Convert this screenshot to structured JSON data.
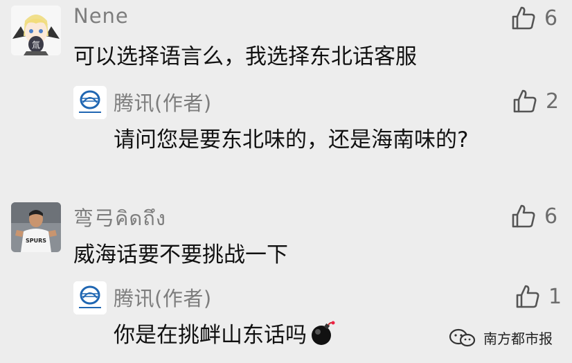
{
  "comments": [
    {
      "username": "Nene",
      "text": "可以选择语言么，我选择东北话客服",
      "likes": "6",
      "reply": {
        "username": "腾讯(作者)",
        "text": "请问您是要东北味的，还是海南味的?",
        "likes": "2"
      }
    },
    {
      "username": "弯弓คิดถึง",
      "text": "威海话要不要挑战一下",
      "likes": "6",
      "reply": {
        "username": "腾讯(作者)",
        "text": "你是在挑衅山东话吗",
        "likes": "1"
      }
    }
  ],
  "icons": {
    "like": "thumbs-up-icon",
    "emoji": "bomb-emoji-icon",
    "author_logo": "tencent-logo",
    "watermark": "wechat-channel-icon"
  },
  "watermark": {
    "text": "南方都市报"
  },
  "colors": {
    "background": "#ededed",
    "name": "#7d7d7d",
    "text": "#111111",
    "like_outline": "#5a5a5a"
  }
}
